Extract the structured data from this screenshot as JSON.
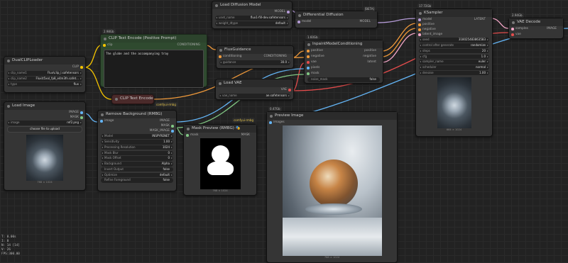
{
  "colors": {
    "canvas_bg": "#222222",
    "node_bg": "#353535",
    "title_bg": "#2b2b2b",
    "green_node": "#2f4a2f",
    "red_node": "#4a2a2a",
    "wire_clip": "#f5c400",
    "wire_model": "#b59bd7",
    "wire_cond": "#f09a3b",
    "wire_latent": "#f4a7c8",
    "wire_vae": "#e34c4c",
    "wire_image": "#64b5f6",
    "wire_mask": "#81c784"
  },
  "nodes": {
    "load_diffusion": {
      "title": "Load Diffusion Model",
      "out_model": "MODEL",
      "unet_label": "unet_name",
      "unet_value": "flux1-fill-dev.safetensors",
      "dtype_label": "weight_dtype",
      "dtype_value": "default"
    },
    "diff_diffusion": {
      "title": "Differential Diffusion",
      "badge": "[BETA]",
      "in_model": "model",
      "out_model": "MODEL"
    },
    "dual_clip": {
      "title": "DualCLIPLoader",
      "out_clip": "CLIP",
      "c1_label": "clip_name1",
      "c1_value": "Flux\\clip_l.safetensors",
      "c2_label": "clip_name2",
      "c2_value": "Flux\\t5xxl_fp8_e4m3fn.safet...",
      "type_label": "type",
      "type_value": "flux"
    },
    "clip_pos": {
      "title": "CLIP Text Encode (Positive Prompt)",
      "badge": "2.98Gb",
      "in_clip": "clip",
      "out_cond": "CONDITIONING",
      "text": "The globe and the accompanying tray"
    },
    "flux_guidance": {
      "title": "FluxGuidance",
      "in_cond": "conditioning",
      "out_cond": "CONDITIONING",
      "g_label": "guidance",
      "g_value": "30.0"
    },
    "clip_neg": {
      "title": "CLIP Text Encode (Ne",
      "in_clip": "clip"
    },
    "inpaint": {
      "title": "InpaintModelConditioning",
      "badge": "1.60Gb",
      "in_pos": "positive",
      "in_neg": "negative",
      "in_vae": "vae",
      "in_pixels": "pixels",
      "in_mask": "mask",
      "out_pos": "positive",
      "out_neg": "negative",
      "out_latent": "latent",
      "noise_label": "noise_mask",
      "noise_value": "false"
    },
    "load_vae": {
      "title": "Load VAE",
      "out_vae": "VAE",
      "vae_label": "vae_name",
      "vae_value": "ae.safetensors"
    },
    "ksampler": {
      "title": "KSampler",
      "badge": "17.72Gb",
      "in_model": "model",
      "in_pos": "positive",
      "in_neg": "negative",
      "in_latent": "latent_image",
      "out_latent": "LATENT",
      "seed_label": "seed",
      "seed_value": "318025483863583",
      "ctrl_label": "control after generate",
      "ctrl_value": "randomize",
      "steps_label": "steps",
      "steps_value": "20",
      "cfg_label": "cfg",
      "cfg_value": "1.0",
      "sampler_label": "sampler_name",
      "sampler_value": "euler",
      "sched_label": "scheduler",
      "sched_value": "normal",
      "denoise_label": "denoise",
      "denoise_value": "1.00",
      "caption": "664 × 1024"
    },
    "vae_decode": {
      "title": "VAE Decode",
      "badge": "2.94Gb",
      "in_samples": "samples",
      "in_vae": "vae",
      "out_image": "IMAGE"
    },
    "load_image": {
      "title": "Load Image",
      "out_image": "IMAGE",
      "out_mask": "MASK",
      "img_label": "image",
      "img_value": "ref2.png",
      "upload": "choose file to upload",
      "caption": "768 × 1024"
    },
    "rmbg": {
      "title": "Remove Background (RMBG)",
      "badge": "comfyui-rmbg",
      "in_image": "image",
      "out_image": "IMAGE",
      "out_mask": "MASK",
      "out_mask_image": "MASK_IMAGE",
      "model_label": "Model",
      "model_value": "INSPYRENET",
      "sens_label": "Sensitivity",
      "sens_value": "1.00",
      "res_label": "Processing Resolution",
      "res_value": "1024",
      "blur_label": "Mask Blur",
      "blur_value": "0",
      "offset_label": "Mask Offset",
      "offset_value": "0",
      "bg_label": "Background",
      "bg_value": "Alpha",
      "invert_label": "Invert Output",
      "invert_value": "false",
      "opt_label": "Optimize",
      "opt_value": "default",
      "refine_label": "Refine Foreground",
      "refine_value": "false"
    },
    "mask_preview": {
      "title": "Mask Preview (RMBG) 🎭",
      "badge": "comfyui-rmbg",
      "in_mask": "mask",
      "out_mask": "MASK",
      "caption": "768 × 1024"
    },
    "preview": {
      "title": "Preview Image",
      "badge": "0.47Gb",
      "in_images": "images",
      "caption": "768 × 1024"
    }
  },
  "stats": [
    "T: 0.00s",
    "I: 0",
    "N: 14 [14]",
    "V: 26",
    "FPS:300.00"
  ]
}
